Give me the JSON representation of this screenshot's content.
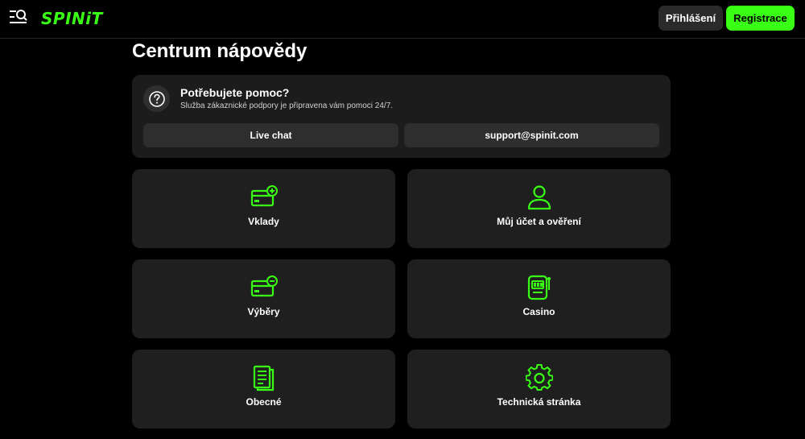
{
  "header": {
    "logo_text": "SPINiT",
    "login_label": "Přihlášení",
    "register_label": "Registrace"
  },
  "page": {
    "title": "Centrum nápovědy"
  },
  "help": {
    "title": "Potřebujete pomoc?",
    "subtitle": "Služba zákaznické podpory je připravena vám pomoci 24/7.",
    "chat_label": "Live chat",
    "email_label": "support@spinit.com"
  },
  "categories": [
    {
      "label": "Vklady",
      "icon": "card-plus-icon"
    },
    {
      "label": "Můj účet a ověření",
      "icon": "user-icon"
    },
    {
      "label": "Výběry",
      "icon": "card-minus-icon"
    },
    {
      "label": "Casino",
      "icon": "slot-machine-icon"
    },
    {
      "label": "Obecné",
      "icon": "document-icon"
    },
    {
      "label": "Technická stránka",
      "icon": "gear-icon"
    }
  ],
  "colors": {
    "accent": "#39ff14",
    "background": "#000000",
    "card": "#1f1f1f",
    "button_dark": "#2a2a2a"
  }
}
